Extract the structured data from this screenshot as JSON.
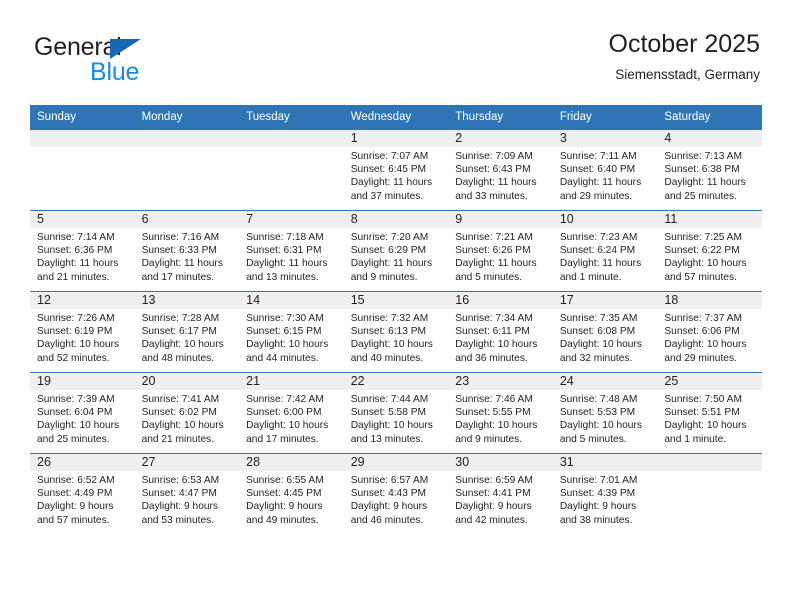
{
  "brand": {
    "name_line1": "General",
    "name_line2": "Blue",
    "triangle_color": "#1668b3",
    "blue_color": "#1a8bd6"
  },
  "header": {
    "title": "October 2025",
    "subtitle": "Siemensstadt, Germany"
  },
  "theme": {
    "header_blue": "#2e75b6",
    "daynum_band": "#efefef",
    "text": "#231f20"
  },
  "weekday_headers": [
    "Sunday",
    "Monday",
    "Tuesday",
    "Wednesday",
    "Thursday",
    "Friday",
    "Saturday"
  ],
  "weeks": [
    [
      {
        "day": "",
        "sunrise": "",
        "sunset": "",
        "daylight_line1": "",
        "daylight_line2": ""
      },
      {
        "day": "",
        "sunrise": "",
        "sunset": "",
        "daylight_line1": "",
        "daylight_line2": ""
      },
      {
        "day": "",
        "sunrise": "",
        "sunset": "",
        "daylight_line1": "",
        "daylight_line2": ""
      },
      {
        "day": "1",
        "sunrise": "Sunrise: 7:07 AM",
        "sunset": "Sunset: 6:45 PM",
        "daylight_line1": "Daylight: 11 hours",
        "daylight_line2": "and 37 minutes."
      },
      {
        "day": "2",
        "sunrise": "Sunrise: 7:09 AM",
        "sunset": "Sunset: 6:43 PM",
        "daylight_line1": "Daylight: 11 hours",
        "daylight_line2": "and 33 minutes."
      },
      {
        "day": "3",
        "sunrise": "Sunrise: 7:11 AM",
        "sunset": "Sunset: 6:40 PM",
        "daylight_line1": "Daylight: 11 hours",
        "daylight_line2": "and 29 minutes."
      },
      {
        "day": "4",
        "sunrise": "Sunrise: 7:13 AM",
        "sunset": "Sunset: 6:38 PM",
        "daylight_line1": "Daylight: 11 hours",
        "daylight_line2": "and 25 minutes."
      }
    ],
    [
      {
        "day": "5",
        "sunrise": "Sunrise: 7:14 AM",
        "sunset": "Sunset: 6:36 PM",
        "daylight_line1": "Daylight: 11 hours",
        "daylight_line2": "and 21 minutes."
      },
      {
        "day": "6",
        "sunrise": "Sunrise: 7:16 AM",
        "sunset": "Sunset: 6:33 PM",
        "daylight_line1": "Daylight: 11 hours",
        "daylight_line2": "and 17 minutes."
      },
      {
        "day": "7",
        "sunrise": "Sunrise: 7:18 AM",
        "sunset": "Sunset: 6:31 PM",
        "daylight_line1": "Daylight: 11 hours",
        "daylight_line2": "and 13 minutes."
      },
      {
        "day": "8",
        "sunrise": "Sunrise: 7:20 AM",
        "sunset": "Sunset: 6:29 PM",
        "daylight_line1": "Daylight: 11 hours",
        "daylight_line2": "and 9 minutes."
      },
      {
        "day": "9",
        "sunrise": "Sunrise: 7:21 AM",
        "sunset": "Sunset: 6:26 PM",
        "daylight_line1": "Daylight: 11 hours",
        "daylight_line2": "and 5 minutes."
      },
      {
        "day": "10",
        "sunrise": "Sunrise: 7:23 AM",
        "sunset": "Sunset: 6:24 PM",
        "daylight_line1": "Daylight: 11 hours",
        "daylight_line2": "and 1 minute."
      },
      {
        "day": "11",
        "sunrise": "Sunrise: 7:25 AM",
        "sunset": "Sunset: 6:22 PM",
        "daylight_line1": "Daylight: 10 hours",
        "daylight_line2": "and 57 minutes."
      }
    ],
    [
      {
        "day": "12",
        "sunrise": "Sunrise: 7:26 AM",
        "sunset": "Sunset: 6:19 PM",
        "daylight_line1": "Daylight: 10 hours",
        "daylight_line2": "and 52 minutes."
      },
      {
        "day": "13",
        "sunrise": "Sunrise: 7:28 AM",
        "sunset": "Sunset: 6:17 PM",
        "daylight_line1": "Daylight: 10 hours",
        "daylight_line2": "and 48 minutes."
      },
      {
        "day": "14",
        "sunrise": "Sunrise: 7:30 AM",
        "sunset": "Sunset: 6:15 PM",
        "daylight_line1": "Daylight: 10 hours",
        "daylight_line2": "and 44 minutes."
      },
      {
        "day": "15",
        "sunrise": "Sunrise: 7:32 AM",
        "sunset": "Sunset: 6:13 PM",
        "daylight_line1": "Daylight: 10 hours",
        "daylight_line2": "and 40 minutes."
      },
      {
        "day": "16",
        "sunrise": "Sunrise: 7:34 AM",
        "sunset": "Sunset: 6:11 PM",
        "daylight_line1": "Daylight: 10 hours",
        "daylight_line2": "and 36 minutes."
      },
      {
        "day": "17",
        "sunrise": "Sunrise: 7:35 AM",
        "sunset": "Sunset: 6:08 PM",
        "daylight_line1": "Daylight: 10 hours",
        "daylight_line2": "and 32 minutes."
      },
      {
        "day": "18",
        "sunrise": "Sunrise: 7:37 AM",
        "sunset": "Sunset: 6:06 PM",
        "daylight_line1": "Daylight: 10 hours",
        "daylight_line2": "and 29 minutes."
      }
    ],
    [
      {
        "day": "19",
        "sunrise": "Sunrise: 7:39 AM",
        "sunset": "Sunset: 6:04 PM",
        "daylight_line1": "Daylight: 10 hours",
        "daylight_line2": "and 25 minutes."
      },
      {
        "day": "20",
        "sunrise": "Sunrise: 7:41 AM",
        "sunset": "Sunset: 6:02 PM",
        "daylight_line1": "Daylight: 10 hours",
        "daylight_line2": "and 21 minutes."
      },
      {
        "day": "21",
        "sunrise": "Sunrise: 7:42 AM",
        "sunset": "Sunset: 6:00 PM",
        "daylight_line1": "Daylight: 10 hours",
        "daylight_line2": "and 17 minutes."
      },
      {
        "day": "22",
        "sunrise": "Sunrise: 7:44 AM",
        "sunset": "Sunset: 5:58 PM",
        "daylight_line1": "Daylight: 10 hours",
        "daylight_line2": "and 13 minutes."
      },
      {
        "day": "23",
        "sunrise": "Sunrise: 7:46 AM",
        "sunset": "Sunset: 5:55 PM",
        "daylight_line1": "Daylight: 10 hours",
        "daylight_line2": "and 9 minutes."
      },
      {
        "day": "24",
        "sunrise": "Sunrise: 7:48 AM",
        "sunset": "Sunset: 5:53 PM",
        "daylight_line1": "Daylight: 10 hours",
        "daylight_line2": "and 5 minutes."
      },
      {
        "day": "25",
        "sunrise": "Sunrise: 7:50 AM",
        "sunset": "Sunset: 5:51 PM",
        "daylight_line1": "Daylight: 10 hours",
        "daylight_line2": "and 1 minute."
      }
    ],
    [
      {
        "day": "26",
        "sunrise": "Sunrise: 6:52 AM",
        "sunset": "Sunset: 4:49 PM",
        "daylight_line1": "Daylight: 9 hours",
        "daylight_line2": "and 57 minutes."
      },
      {
        "day": "27",
        "sunrise": "Sunrise: 6:53 AM",
        "sunset": "Sunset: 4:47 PM",
        "daylight_line1": "Daylight: 9 hours",
        "daylight_line2": "and 53 minutes."
      },
      {
        "day": "28",
        "sunrise": "Sunrise: 6:55 AM",
        "sunset": "Sunset: 4:45 PM",
        "daylight_line1": "Daylight: 9 hours",
        "daylight_line2": "and 49 minutes."
      },
      {
        "day": "29",
        "sunrise": "Sunrise: 6:57 AM",
        "sunset": "Sunset: 4:43 PM",
        "daylight_line1": "Daylight: 9 hours",
        "daylight_line2": "and 46 minutes."
      },
      {
        "day": "30",
        "sunrise": "Sunrise: 6:59 AM",
        "sunset": "Sunset: 4:41 PM",
        "daylight_line1": "Daylight: 9 hours",
        "daylight_line2": "and 42 minutes."
      },
      {
        "day": "31",
        "sunrise": "Sunrise: 7:01 AM",
        "sunset": "Sunset: 4:39 PM",
        "daylight_line1": "Daylight: 9 hours",
        "daylight_line2": "and 38 minutes."
      },
      {
        "day": "",
        "sunrise": "",
        "sunset": "",
        "daylight_line1": "",
        "daylight_line2": ""
      }
    ]
  ]
}
